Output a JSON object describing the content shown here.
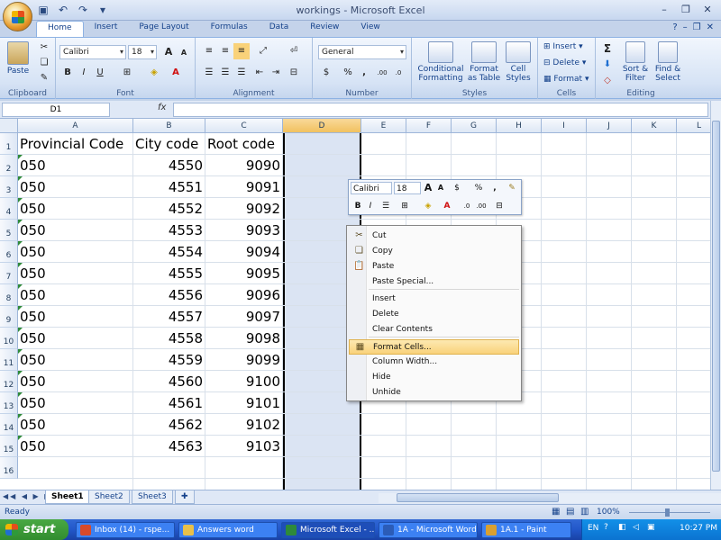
{
  "window": {
    "title": "workings  -  Microsoft Excel"
  },
  "ribbon": {
    "tabs": [
      "Home",
      "Insert",
      "Page Layout",
      "Formulas",
      "Data",
      "Review",
      "View"
    ],
    "clipboard": {
      "paste_label": "Paste",
      "group_label": "Clipboard"
    },
    "font": {
      "font_name": "Calibri",
      "font_size": "18",
      "group_label": "Font",
      "bold": "B",
      "italic": "I",
      "underline": "U",
      "grow": "A",
      "shrink": "A"
    },
    "alignment": {
      "group_label": "Alignment"
    },
    "number": {
      "format": "General",
      "currency": "$",
      "percent": "%",
      "comma": ",",
      "group_label": "Number"
    },
    "styles": {
      "conditional_formatting": "Conditional Formatting",
      "format_as_table": "Format as Table",
      "cell_styles": "Cell Styles",
      "group_label": "Styles"
    },
    "cells": {
      "insert": "Insert",
      "delete": "Delete",
      "format": "Format",
      "group_label": "Cells"
    },
    "editing": {
      "sum": "Σ",
      "sort_filter": "Sort & Filter",
      "find_select": "Find & Select",
      "group_label": "Editing"
    }
  },
  "formula_bar": {
    "name_box": "D1",
    "fx": "fx",
    "formula": ""
  },
  "grid": {
    "columns": [
      "A",
      "B",
      "C",
      "D",
      "E",
      "F",
      "G",
      "H",
      "I",
      "J",
      "K",
      "L"
    ],
    "selected_column": "D",
    "headers": [
      "Provincial Code",
      "City code",
      "Root code"
    ],
    "rows": [
      [
        "050",
        "4550",
        "9090"
      ],
      [
        "050",
        "4551",
        "9091"
      ],
      [
        "050",
        "4552",
        "9092"
      ],
      [
        "050",
        "4553",
        "9093"
      ],
      [
        "050",
        "4554",
        "9094"
      ],
      [
        "050",
        "4555",
        "9095"
      ],
      [
        "050",
        "4556",
        "9096"
      ],
      [
        "050",
        "4557",
        "9097"
      ],
      [
        "050",
        "4558",
        "9098"
      ],
      [
        "050",
        "4559",
        "9099"
      ],
      [
        "050",
        "4560",
        "9100"
      ],
      [
        "050",
        "4561",
        "9101"
      ],
      [
        "050",
        "4562",
        "9102"
      ],
      [
        "050",
        "4563",
        "9103"
      ]
    ],
    "row_numbers": [
      "1",
      "2",
      "3",
      "4",
      "5",
      "6",
      "7",
      "8",
      "9",
      "10",
      "11",
      "12",
      "13",
      "14",
      "15",
      "16"
    ]
  },
  "mini_toolbar": {
    "font_name": "Calibri",
    "font_size": "18",
    "grow": "A",
    "shrink": "A",
    "currency": "$",
    "percent": "%",
    "comma": ",",
    "bold": "B",
    "italic": "I"
  },
  "context_menu": {
    "items": [
      {
        "label": "Cut",
        "icon": "scissors-icon"
      },
      {
        "label": "Copy",
        "icon": "copy-icon"
      },
      {
        "label": "Paste",
        "icon": "paste-icon"
      },
      {
        "label": "Paste Special...",
        "icon": ""
      },
      {
        "label": "Insert",
        "icon": ""
      },
      {
        "label": "Delete",
        "icon": ""
      },
      {
        "label": "Clear Contents",
        "icon": ""
      },
      {
        "label": "Format Cells...",
        "icon": "format-cells-icon",
        "highlighted": true
      },
      {
        "label": "Column Width...",
        "icon": ""
      },
      {
        "label": "Hide",
        "icon": ""
      },
      {
        "label": "Unhide",
        "icon": ""
      }
    ]
  },
  "sheets": [
    "Sheet1",
    "Sheet2",
    "Sheet3"
  ],
  "active_sheet": "Sheet1",
  "status": {
    "ready": "Ready",
    "zoom": "100%"
  },
  "taskbar": {
    "start": "start",
    "items": [
      {
        "label": "Inbox (14) - rspe...",
        "icon_color": "#d84a2a"
      },
      {
        "label": "Answers word",
        "icon_color": "#e8c04a"
      },
      {
        "label": "Microsoft Excel - ...",
        "icon_color": "#2e8a3a",
        "active": true
      },
      {
        "label": "1A - Microsoft Word",
        "icon_color": "#2b5cb8"
      },
      {
        "label": "1A.1 - Paint",
        "icon_color": "#d9a030"
      }
    ],
    "language": "EN",
    "time": "10:27 PM"
  },
  "colors": {
    "ribbon_blue": "#15428b",
    "highlight": "#f9d27a",
    "selected_col_bg": "#dbe4f3",
    "taskbar_blue": "#2257c9",
    "start_green": "#318d2f"
  }
}
